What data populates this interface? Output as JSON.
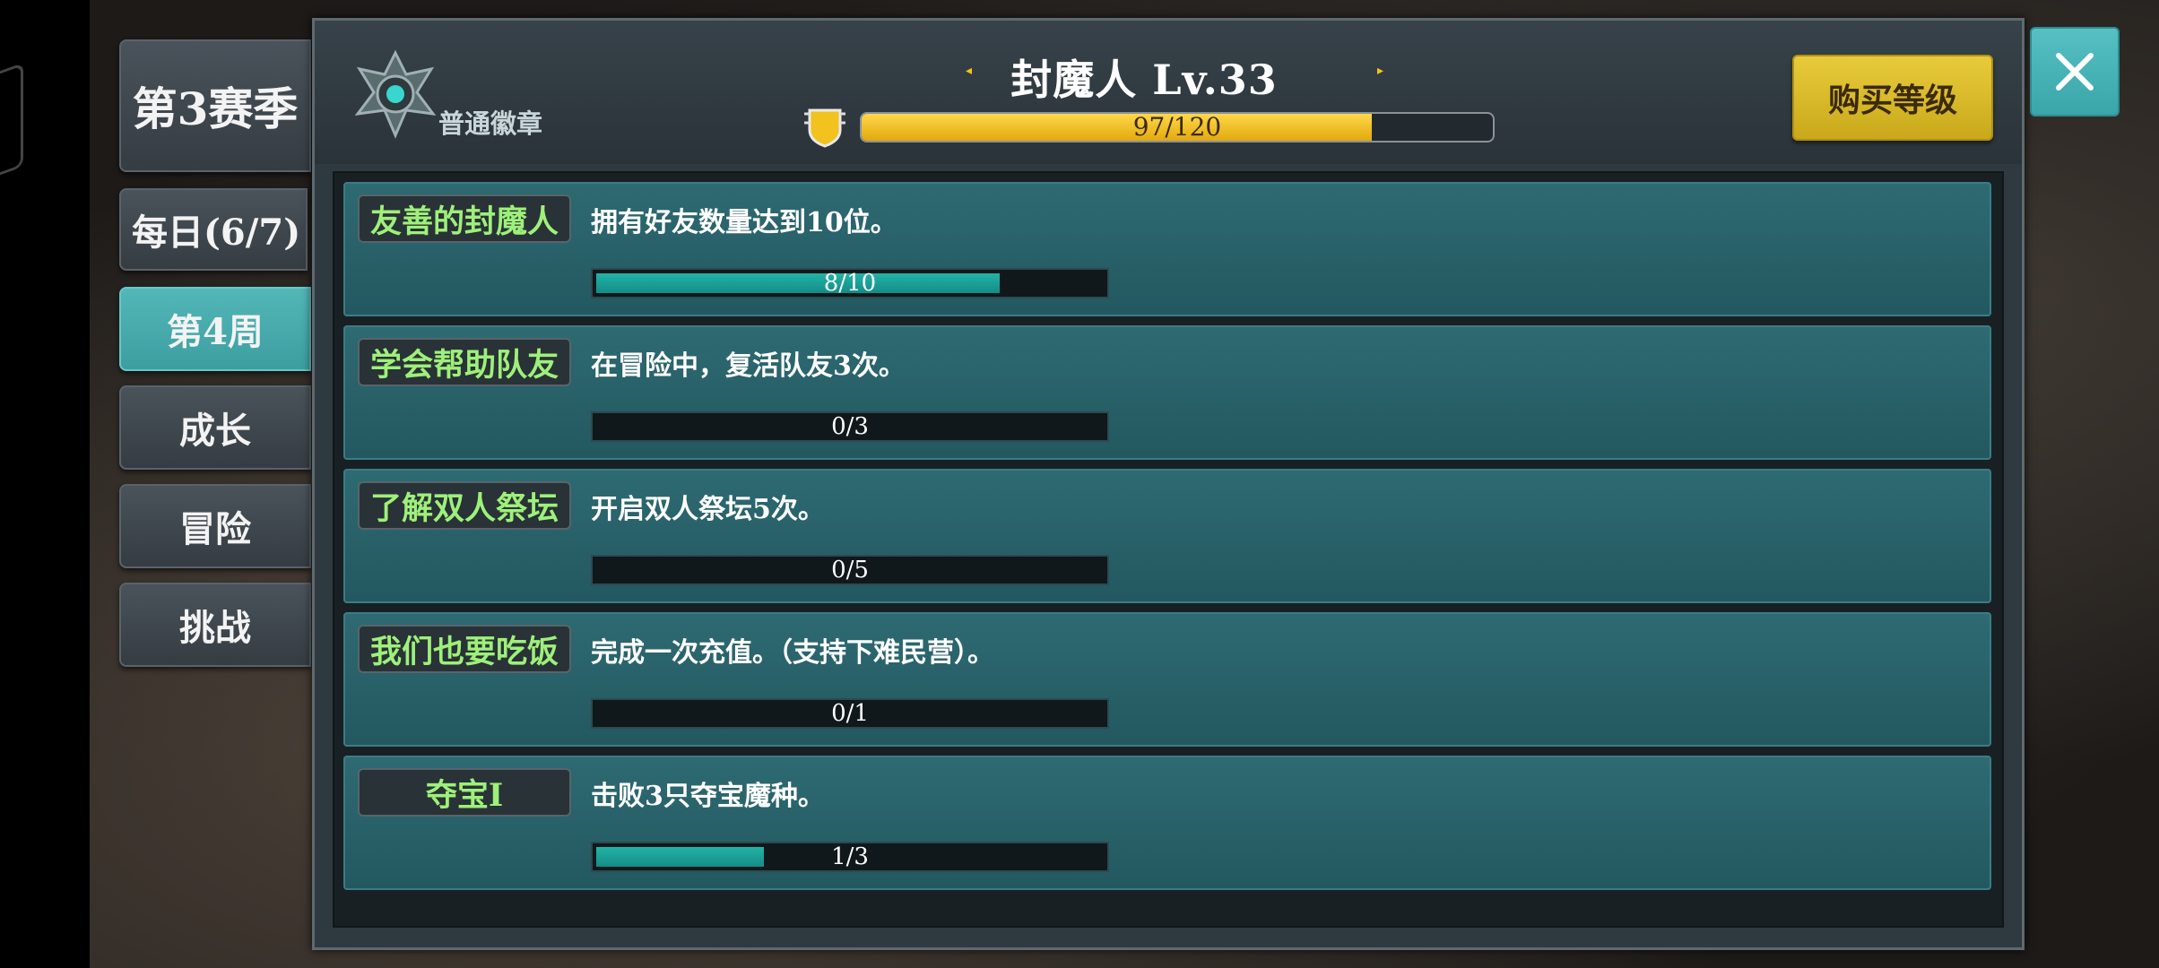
{
  "sidebar": {
    "tabs": [
      {
        "label": "第3赛季"
      },
      {
        "label": "每日(6/7)"
      },
      {
        "label": "第4周"
      },
      {
        "label": "成长"
      },
      {
        "label": "冒险"
      },
      {
        "label": "挑战"
      }
    ],
    "active_tab": "第4周"
  },
  "header": {
    "badge_label": "普通徽章",
    "title": "封魔人 Lv.33",
    "xp": {
      "text": "97/120",
      "current": 97,
      "max": 120
    },
    "buy_button": "购买等级",
    "close_icon": "close-icon"
  },
  "quests": [
    {
      "name": "友善的封魔人",
      "desc": "拥有好友数量达到10位。",
      "progress": "8/10",
      "current": 8,
      "max": 10
    },
    {
      "name": "学会帮助队友",
      "desc": "在冒险中，复活队友3次。",
      "progress": "0/3",
      "current": 0,
      "max": 3
    },
    {
      "name": "了解双人祭坛",
      "desc": "开启双人祭坛5次。",
      "progress": "0/5",
      "current": 0,
      "max": 5
    },
    {
      "name": "我们也要吃饭",
      "desc": "完成一次充值。（支持下难民营）。",
      "progress": "0/1",
      "current": 0,
      "max": 1
    },
    {
      "name": "夺宝I",
      "desc": "击败3只夺宝魔种。",
      "progress": "1/3",
      "current": 1,
      "max": 3
    }
  ],
  "colors": {
    "active_tab": "#4fb3b5",
    "quest_name": "#9ef07a",
    "xp_fill": "#f0c020",
    "buy_button": "#e0c12e",
    "progress_fill": "#1ea79c"
  }
}
